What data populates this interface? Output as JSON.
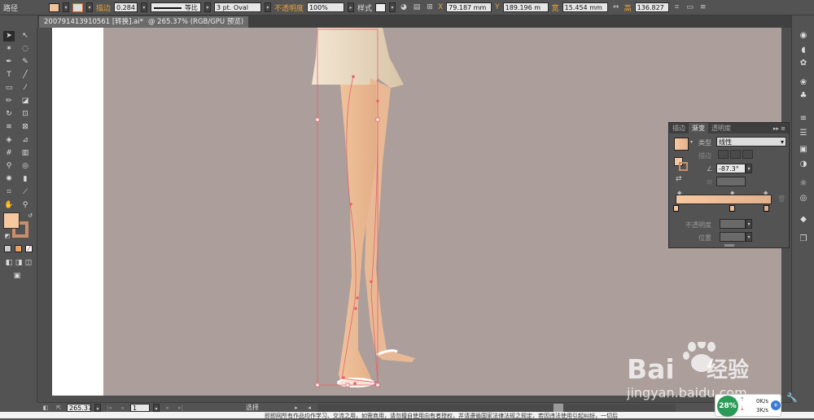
{
  "control_bar": {
    "object_type": "路径",
    "fill_color": "#f2c39a",
    "stroke_label": "描边",
    "stroke_weight": "0.284",
    "stroke_profile": "等比",
    "brush": "3 pt. Oval",
    "opacity_label": "不透明度",
    "opacity_value": "100%",
    "style_label": "样式",
    "x_label": "X",
    "x_value": "79.187 mm",
    "y_label": "Y",
    "y_value": "189.196 m",
    "w_label": "宽",
    "w_value": "15.454 mm",
    "h_label": "高",
    "h_value": "136.827"
  },
  "document_tab": {
    "filename": "200791413910561 [转换].ai*",
    "zoom_mode": "@ 265.37% (RGB/GPU 预览)"
  },
  "tools": {
    "fill_color": "#f5c8a0",
    "stroke_color": "#c98f6a"
  },
  "gradient_panel": {
    "tabs": [
      "描边",
      "渐变",
      "透明度"
    ],
    "active_tab": "渐变",
    "type_label": "类型",
    "type_value": "线性",
    "stroke_label": "描边",
    "angle_value": "-87.3°",
    "opacity_label": "不透明度",
    "location_label": "位置",
    "gradient_start": "#f7c9a1",
    "gradient_end": "#e3b08c"
  },
  "status_bar": {
    "zoom": "265.37",
    "page": "1",
    "tool_name": "选择"
  },
  "network_widget": {
    "percent": "28%",
    "up_speed": "0K/s",
    "down_speed": "3K/s"
  },
  "watermark": {
    "brand": "Bai",
    "brand2": "经验",
    "url": "jingyan.baidu.com"
  },
  "footer_text": "即即网所有作品均作学习、交流之用，如需商用，请勿擅自使用向有者授权，并请遵循国家法律法规之规定，若因违法使用引起纠纷，一切后"
}
